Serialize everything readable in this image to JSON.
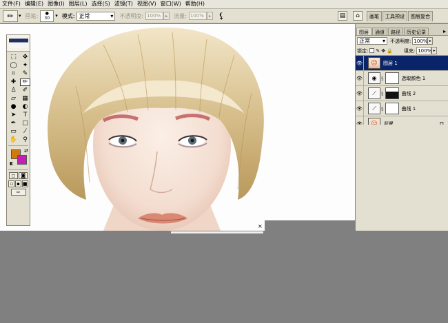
{
  "menu": [
    "文件(F)",
    "编辑(E)",
    "图像(I)",
    "图层(L)",
    "选择(S)",
    "滤镜(T)",
    "视图(V)",
    "窗口(W)",
    "帮助(H)"
  ],
  "options": {
    "tool_icon": "brush-icon",
    "brush_label": "画笔:",
    "brush_size": "30",
    "mode_label": "模式:",
    "mode_value": "正常",
    "opacity_label": "不透明度:",
    "opacity_value": "100%",
    "flow_label": "流量:",
    "flow_value": "100%",
    "well_tabs": [
      "画笔",
      "工具预设",
      "图层复合"
    ]
  },
  "toolbox": {
    "tools": [
      {
        "name": "marquee-icon",
        "glyph": "⬚"
      },
      {
        "name": "move-icon",
        "glyph": "✥"
      },
      {
        "name": "lasso-icon",
        "glyph": "◯"
      },
      {
        "name": "magic-wand-icon",
        "glyph": "✦"
      },
      {
        "name": "crop-icon",
        "glyph": "⌗"
      },
      {
        "name": "slice-icon",
        "glyph": "✎"
      },
      {
        "name": "healing-icon",
        "glyph": "✚"
      },
      {
        "name": "brush-icon",
        "glyph": "✏"
      },
      {
        "name": "stamp-icon",
        "glyph": "♙"
      },
      {
        "name": "history-brush-icon",
        "glyph": "✐"
      },
      {
        "name": "eraser-icon",
        "glyph": "▱"
      },
      {
        "name": "gradient-icon",
        "glyph": "▦"
      },
      {
        "name": "blur-icon",
        "glyph": "●"
      },
      {
        "name": "dodge-icon",
        "glyph": "◐"
      },
      {
        "name": "path-select-icon",
        "glyph": "➤"
      },
      {
        "name": "type-icon",
        "glyph": "T"
      },
      {
        "name": "pen-icon",
        "glyph": "✒"
      },
      {
        "name": "shape-icon",
        "glyph": "□"
      },
      {
        "name": "notes-icon",
        "glyph": "▭"
      },
      {
        "name": "eyedropper-icon",
        "glyph": "⁄"
      },
      {
        "name": "hand-icon",
        "glyph": "✋"
      },
      {
        "name": "zoom-icon",
        "glyph": "⚲"
      }
    ],
    "foreground_color": "#d47a0c",
    "background_color": "#c21fb3"
  },
  "layers_panel": {
    "tabs": [
      "图层",
      "通道",
      "路径",
      "历史记录"
    ],
    "blend_mode": "正常",
    "opacity_label": "不透明度:",
    "opacity_value": "100%",
    "lock_label": "锁定:",
    "fill_label": "填充:",
    "fill_value": "100%",
    "layers": [
      {
        "name": "图层 1",
        "type": "pixel",
        "selected": true
      },
      {
        "name": "选取颜色 1",
        "type": "selective-color"
      },
      {
        "name": "曲线 2",
        "type": "curves"
      },
      {
        "name": "曲线 1",
        "type": "curves"
      },
      {
        "name": "背景",
        "type": "background",
        "locked": true
      }
    ]
  },
  "colors": {
    "menubar": "#e8e6dc",
    "panel": "#e3e0d2",
    "selection": "#0a246a",
    "workspace": "#808080"
  }
}
